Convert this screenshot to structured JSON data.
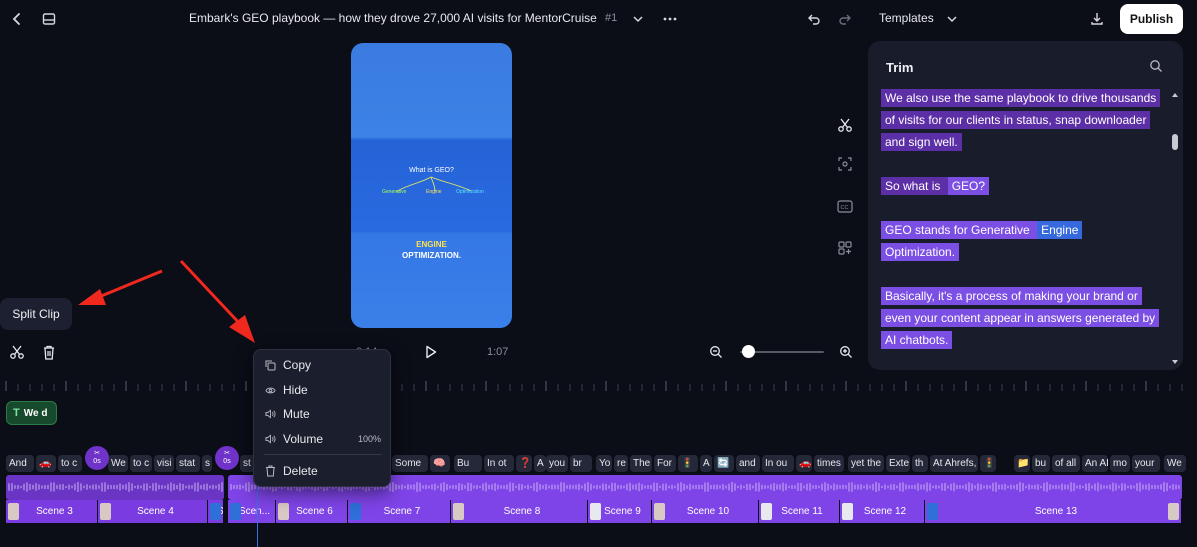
{
  "toolbar": {
    "back_icon": "chevron-left-icon",
    "layout_icon": "panel-layout-icon",
    "title": "Embark's GEO playbook — how they drove 27,000 AI visits for MentorCruise",
    "title_number": "#1",
    "undo_icon": "undo-icon",
    "redo_icon": "redo-icon",
    "templates_label": "Templates",
    "download_icon": "download-icon",
    "publish_label": "Publish"
  },
  "video": {
    "question": "What is GEO?",
    "labels": [
      "Generative",
      "Engine",
      "Optimization"
    ],
    "caption_line1": "ENGINE",
    "caption_line2": "OPTIMIZATION."
  },
  "side_tools": [
    "scissors-icon",
    "focus-icon",
    "captions-icon",
    "add-elements-icon"
  ],
  "trim_panel": {
    "title": "Trim",
    "paragraphs": [
      {
        "text": "We also use the same playbook to drive thousands of visits for our clients in status, snap downloader and sign well."
      },
      {
        "text_a": "So what is ",
        "text_b": "GEO?"
      },
      {
        "text_a": "GEO stands for Generative ",
        "text_b": "Engine",
        "text_c": "Optimization."
      },
      {
        "text": "Basically, it's a process of making your brand or even your content appear in answers generated by AI chatbots."
      }
    ]
  },
  "callout": {
    "split_clip_label": "Split Clip"
  },
  "playback": {
    "current_time": "0:14",
    "duration": "1:07",
    "zoom_level": 0.05
  },
  "context_menu": {
    "items": [
      {
        "label": "Copy",
        "icon": "copy-icon"
      },
      {
        "label": "Hide",
        "icon": "eye-icon"
      },
      {
        "label": "Mute",
        "icon": "speaker-icon"
      },
      {
        "label": "Volume",
        "icon": "volume-icon",
        "value": "100%"
      },
      {
        "label": "Delete",
        "icon": "trash-icon"
      }
    ]
  },
  "timeline": {
    "text_clip_label": "We d",
    "split_marker_label": "0s",
    "words": [
      "And",
      "🚗",
      "to c",
      "0s",
      "We",
      "to c",
      "visi",
      "stat",
      "s",
      "0s",
      "st",
      "Some",
      "🧠",
      "Bu",
      "In ot",
      "❓",
      "A",
      "you",
      "br",
      "Yo",
      "re",
      "The",
      "For",
      "🚦",
      "A",
      "🔄",
      "and",
      "In ou",
      "🚗",
      "times",
      "yet the",
      "Exte",
      "th",
      "At Ahrefs,",
      "🚦",
      "📁",
      "bu",
      "of all",
      "An AI",
      "mo",
      "your",
      "We"
    ],
    "scenes": [
      "Scene 3",
      "Scene 4",
      "S",
      "Scen...",
      "Scene 6",
      "Scene 7",
      "Scene 8",
      "Scene 9",
      "Scene 10",
      "Scene 11",
      "Scene 12",
      "Scene 13"
    ]
  },
  "accent_colors": {
    "purple": "#7a3ce0",
    "highlight": "#5d2fa6",
    "selected_blue": "#3569dd",
    "text_clip_green": "#174a2c"
  }
}
